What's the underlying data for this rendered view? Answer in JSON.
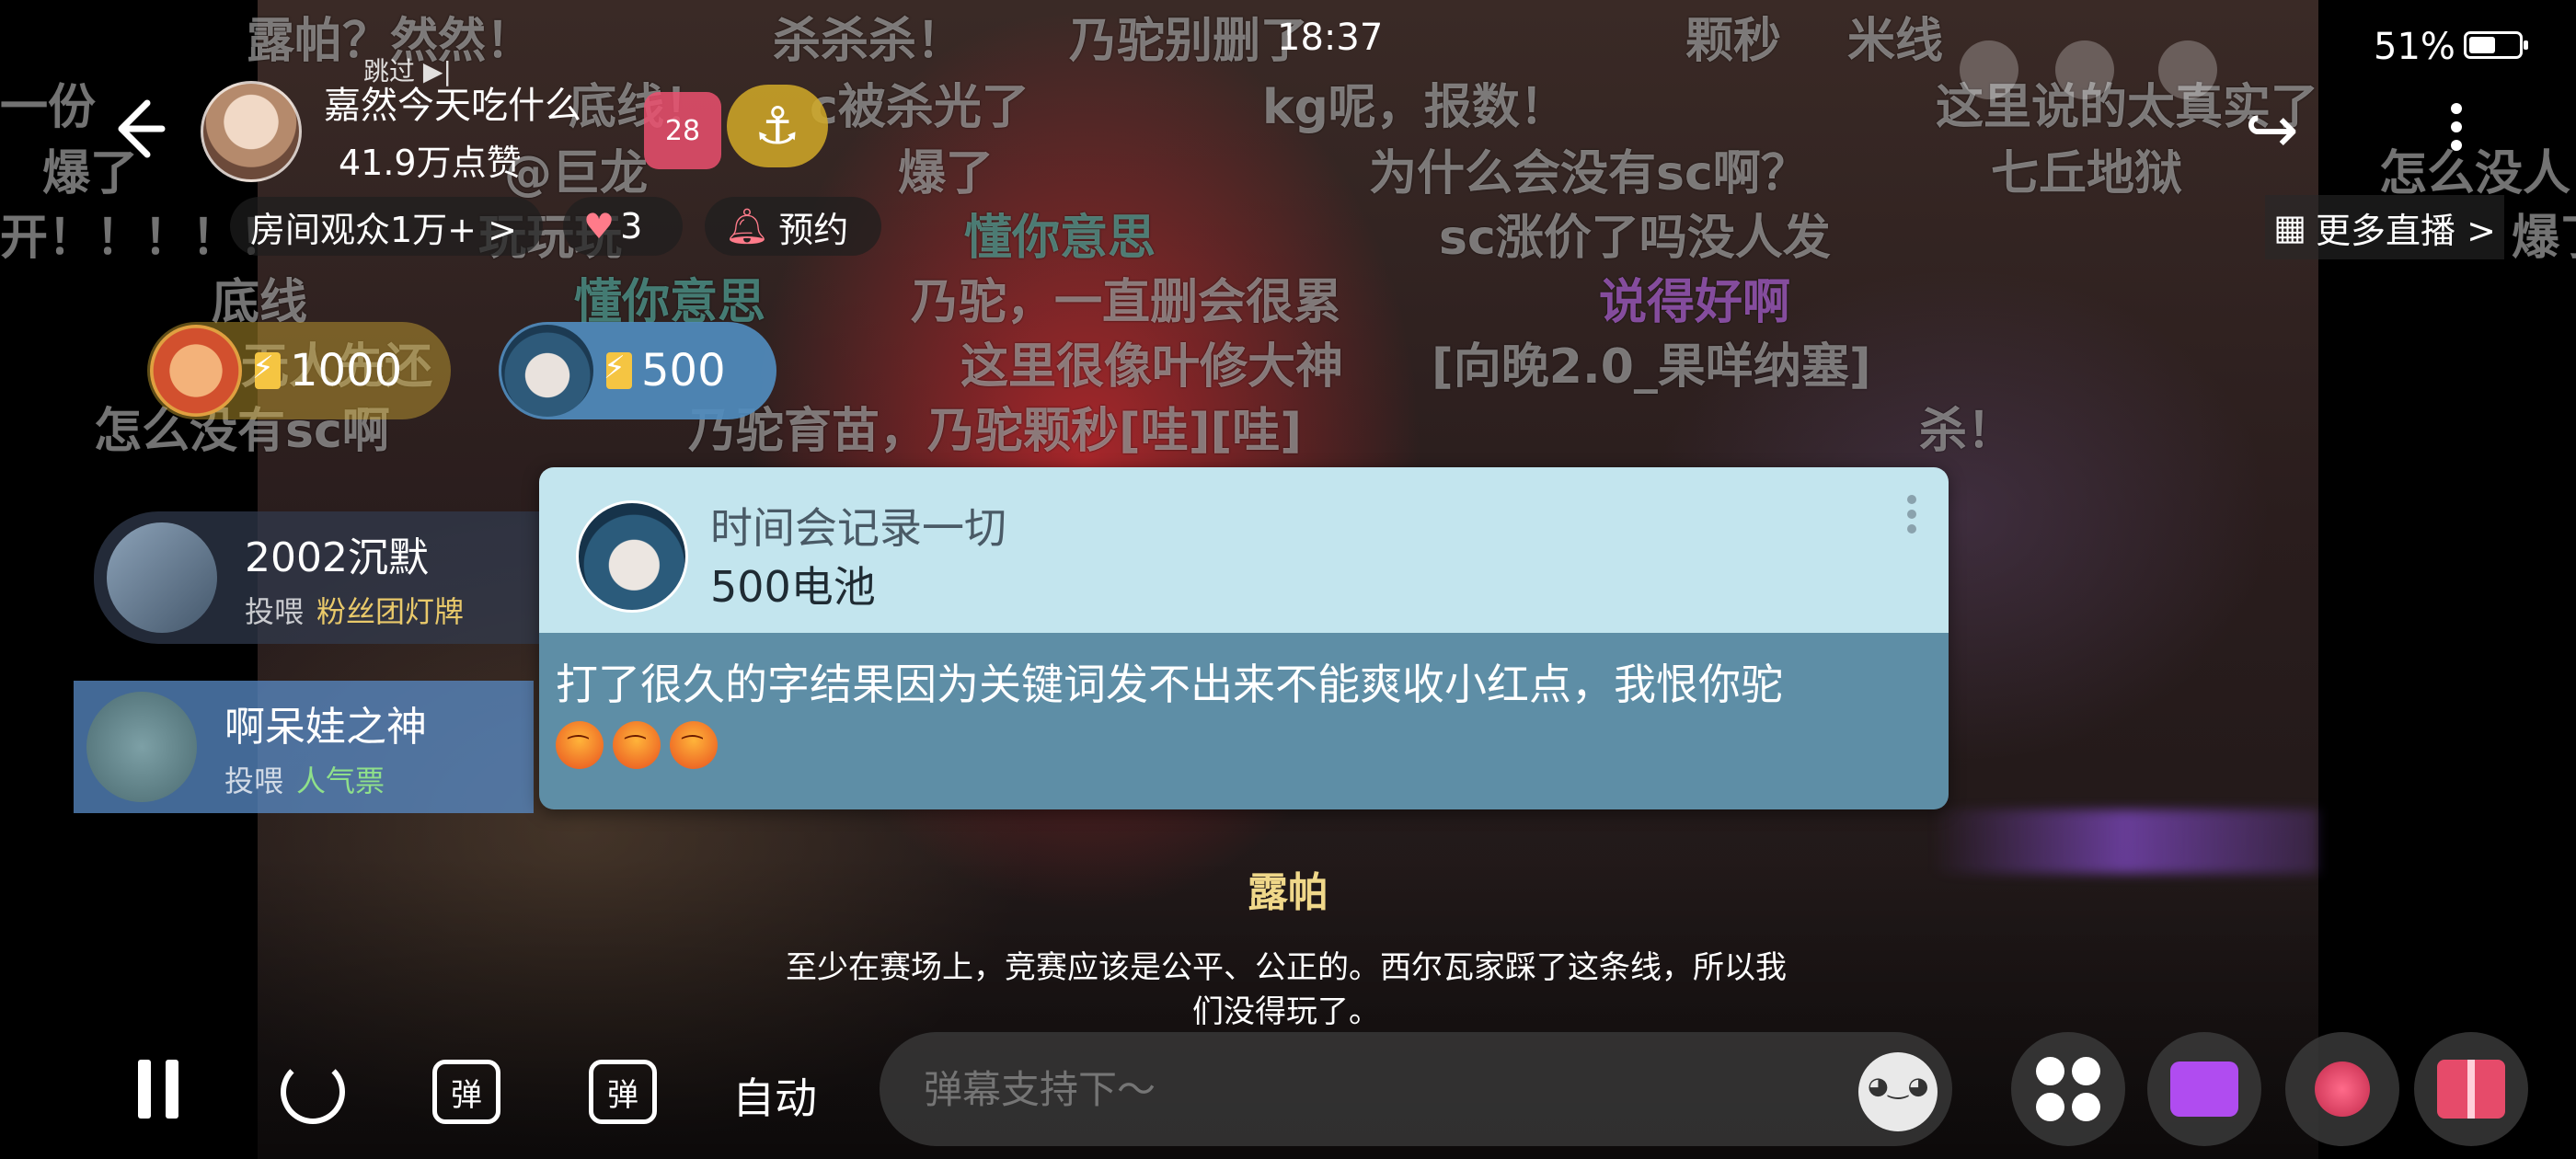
{
  "status_bar": {
    "time": "18:37",
    "battery": "51%",
    "battery_level": 0.51
  },
  "header": {
    "back_icon": "arrow-left-icon",
    "skip_label": "跳过",
    "streamer_name": "嘉然今天吃什么",
    "streamer_likes": "41.9万点赞",
    "heart_level": "28",
    "audience_label": "房间观众1万+ >",
    "likes_count": "3",
    "reserve_label": "预约",
    "more_live_label": "更多直播 >"
  },
  "danmaku": [
    "露帕？然然！",
    "杀杀杀！",
    "乃驼别删了",
    "颗秒",
    "米线",
    "一份",
    "底线！",
    "c被杀光了",
    "kg呢，报数！",
    "这里说的太真实了",
    "爆了",
    "@巨龙",
    "爆了",
    "为什么会没有sc啊？",
    "七丘地狱",
    "怎么没人",
    "开！！！！！",
    "玩玩玩",
    "懂你意思",
    "sc涨价了吗没人发",
    "爆了",
    "底线",
    "懂你意思",
    "乃驼，一直删会很累",
    "说得好啊",
    "无人先还",
    "这里很像叶修大神",
    "[向晚2.0_果咩纳塞]",
    "怎么没有sc啊",
    "乃驼育苗，乃驼颗秒[哇][哇]",
    "杀！"
  ],
  "gift_pills": [
    {
      "amount": "1000"
    },
    {
      "amount": "500"
    }
  ],
  "side_cards": [
    {
      "name": "2002沉默",
      "action": "投喂",
      "gift": "粉丝团灯牌"
    },
    {
      "name": "啊呆娃之神",
      "action": "投喂",
      "gift": "人气票"
    }
  ],
  "superchat": {
    "user": "时间会记录一切",
    "price": "500电池",
    "message": "打了很久的字结果因为关键词发不出来不能爽收小红点，我恨你驼",
    "emoji_count": 3
  },
  "subtitle": {
    "speaker": "露帕",
    "line1": "至少在赛场上，竞赛应该是公平、公正的。西尔瓦家踩了这条线，所以我",
    "line2": "们没得玩了。"
  },
  "controls": {
    "auto_label": "自动",
    "danmu_label": "弹",
    "input_placeholder": "弹幕支持下～"
  },
  "colors": {
    "sc_header": "#c3e5ee",
    "sc_body": "#5e8ea6",
    "gift_pill": "#508cbe"
  }
}
